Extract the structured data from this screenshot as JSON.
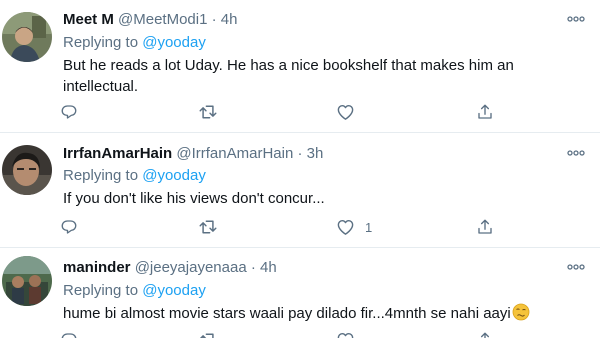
{
  "tweets": [
    {
      "name": "Meet M",
      "handle": "@MeetModi1",
      "dot": "·",
      "time": "4h",
      "replying_prefix": "Replying to",
      "replying_to": "@yooday",
      "text": "But he reads a lot Uday. He has a nice bookshelf that makes him an intellectual.",
      "like_count": ""
    },
    {
      "name": "IrrfanAmarHain",
      "handle": "@IrrfanAmarHain",
      "dot": "·",
      "time": "3h",
      "replying_prefix": "Replying to",
      "replying_to": "@yooday",
      "text": "If you don't like his views don't concur...",
      "like_count": "1"
    },
    {
      "name": "maninder",
      "handle": "@jeeyajayenaaa",
      "dot": "·",
      "time": "4h",
      "replying_prefix": "Replying to",
      "replying_to": "@yooday",
      "text": "hume bi almost movie stars waali pay dilado fir...4mnth se nahi aayi",
      "like_count": ""
    }
  ],
  "icons": {
    "reply": "reply-icon",
    "retweet": "retweet-icon",
    "like": "heart-icon",
    "share": "share-icon",
    "more": "more-options-icon",
    "emoji": "woozy-face-emoji"
  },
  "colors": {
    "link": "#1da1f2",
    "meta": "#5b7083",
    "divider": "#e6ecf0"
  }
}
